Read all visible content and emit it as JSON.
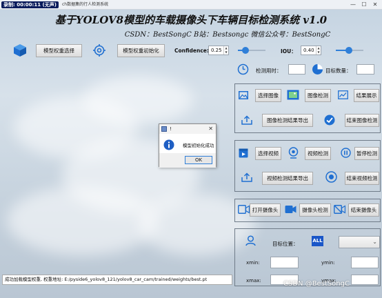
{
  "window": {
    "recorder_badge": "录制: 00:00:11 (无声)",
    "title": "ch数据集的行人检测系统",
    "min": "—",
    "max": "☐",
    "close": "✕"
  },
  "header": {
    "title": "基于YOLOV8模型的车载摄像头下车辆目标检测系统 v1.0",
    "subtitle": "CSDN：BestSongC  B站：Bestsongc  微信公众号：BestSongC"
  },
  "toolbar": {
    "weights_button": "模型权重选择",
    "init_button": "模型权重初始化",
    "confidence_label": "Confidence:",
    "confidence_value": "0.25",
    "confidence_slider": 0.25,
    "iou_label": "IOU：",
    "iou_value": "0.40",
    "iou_slider": 0.4
  },
  "stats": {
    "time_label": "检测用时：",
    "time_value": "",
    "count_label": "目标数量：",
    "count_value": ""
  },
  "image_panel": {
    "select_image": "选择图像",
    "detect_image": "图像检测",
    "show_result": "结果展示",
    "export_image": "图像检测结果导出",
    "end_image": "结束图像检测"
  },
  "video_panel": {
    "select_video": "选择视频",
    "detect_video": "视频检测",
    "pause_detect": "暂停检测",
    "export_video": "视频检测结果导出",
    "end_video": "结束视频检测"
  },
  "camera_panel": {
    "open_camera": "打开摄像头",
    "camera_detect": "摄像头检测",
    "close_camera": "结束摄像头"
  },
  "target_panel": {
    "position_label": "目标位置：",
    "all_badge": "ALL",
    "dropdown_value": "",
    "xmin_label": "xmin:",
    "ymin_label": "ymin:",
    "xmax_label": "xmax:",
    "ymax_label": "ymax:",
    "xmin_value": "",
    "ymin_value": "",
    "xmax_value": "",
    "ymax_value": ""
  },
  "status": {
    "text": "成功加载模型权重, 权重地址: E:/pyside6_yolov8_121/yolov8_car_cam/trained/weights/best.pt"
  },
  "watermark": "CSDN @BestSongC",
  "dialog": {
    "title": "!",
    "message": "模型初始化成功",
    "ok": "OK",
    "close": "✕"
  },
  "colors": {
    "accent": "#2f7fd8",
    "icon_blue": "#1f6fd1",
    "badge_blue": "#1a56c8",
    "recorder_bg": "#0a1c5c"
  }
}
